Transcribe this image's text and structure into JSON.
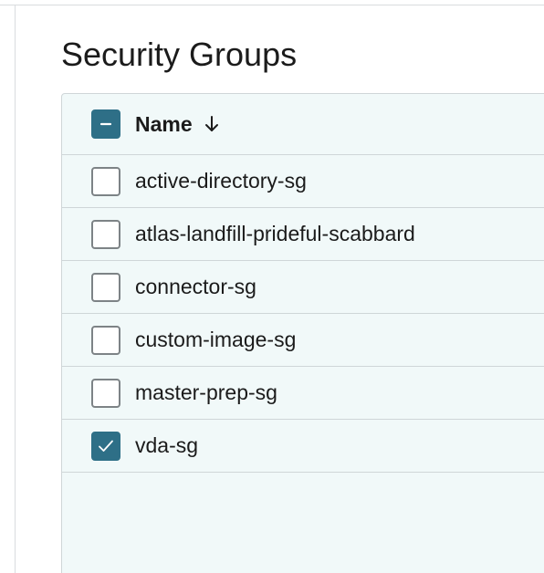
{
  "page": {
    "title": "Security Groups"
  },
  "table": {
    "select_all_state": "indeterminate",
    "columns": [
      {
        "label": "Name",
        "sort": "descending",
        "sort_icon": "arrow-down-icon"
      }
    ],
    "rows": [
      {
        "name": "active-directory-sg",
        "checked": false
      },
      {
        "name": "atlas-landfill-prideful-scabbard",
        "checked": false
      },
      {
        "name": "connector-sg",
        "checked": false
      },
      {
        "name": "custom-image-sg",
        "checked": false
      },
      {
        "name": "master-prep-sg",
        "checked": false
      },
      {
        "name": "vda-sg",
        "checked": true
      }
    ]
  },
  "colors": {
    "accent": "#2e6f87",
    "table_background": "#f1f9f9",
    "border": "#cfd6d8",
    "checkbox_border": "#7d8386"
  }
}
